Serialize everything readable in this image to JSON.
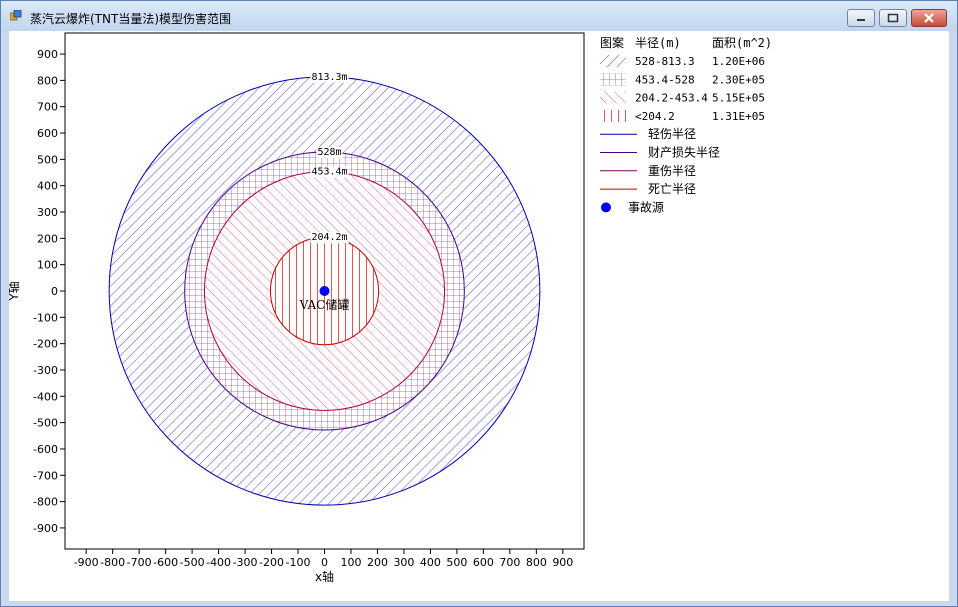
{
  "window": {
    "title": "蒸汽云爆炸(TNT当量法)模型伤害范围"
  },
  "chart_data": {
    "type": "area",
    "xlabel": "x轴",
    "ylabel": "Y轴",
    "xlim": [
      -980,
      980
    ],
    "ylim": [
      -980,
      980
    ],
    "ticks": [
      -900,
      -800,
      -700,
      -600,
      -500,
      -400,
      -300,
      -200,
      -100,
      0,
      100,
      200,
      300,
      400,
      500,
      600,
      700,
      800,
      900
    ],
    "grid": false,
    "legend_position": "right",
    "source": {
      "x": 0,
      "y": 0,
      "label": "VAC储罐",
      "color": "#0000ff"
    },
    "circles": [
      {
        "radius": 813.3,
        "label": "813.3m",
        "color": "#0000b0",
        "hatch": "diag-right",
        "hatch_color": "#2f2fd0"
      },
      {
        "radius": 528,
        "label": "528m",
        "color": "#4b0082",
        "hatch": "grid",
        "hatch_color": "#8e44ad"
      },
      {
        "radius": 453.4,
        "label": "453.4m",
        "color": "#b00040",
        "hatch": "diag-left",
        "hatch_color": "#e05080"
      },
      {
        "radius": 204.2,
        "label": "204.2m",
        "color": "#cc0000",
        "hatch": "vertical",
        "hatch_color": "#e04040"
      }
    ],
    "legend": {
      "headers": [
        "图案",
        "半径(m)",
        "面积(m^2)"
      ],
      "fill_rows": [
        {
          "pattern": "diag-right",
          "range": "528-813.3",
          "area": "1.20E+06"
        },
        {
          "pattern": "grid",
          "range": "453.4-528",
          "area": "2.30E+05"
        },
        {
          "pattern": "diag-left",
          "range": "204.2-453.4",
          "area": "5.15E+05"
        },
        {
          "pattern": "vertical",
          "range": "<204.2",
          "area": "1.31E+05"
        }
      ],
      "line_rows": [
        {
          "label": "轻伤半径",
          "color": "#0000b0"
        },
        {
          "label": "财产损失半径",
          "color": "#4b0082"
        },
        {
          "label": "重伤半径",
          "color": "#800060"
        },
        {
          "label": "死亡半径",
          "color": "#cc0000"
        }
      ],
      "marker_row": {
        "label": "事故源",
        "color": "#0000ff"
      }
    }
  }
}
